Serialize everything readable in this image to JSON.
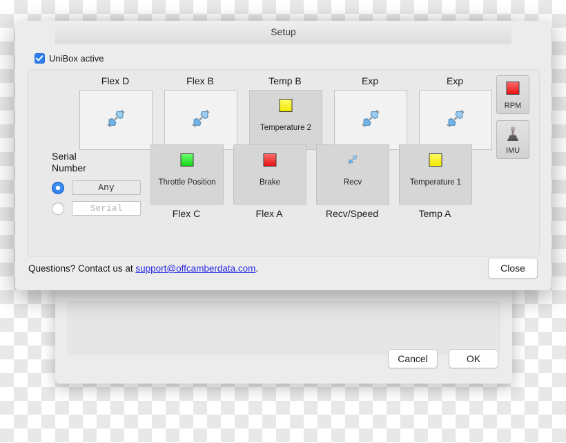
{
  "background_window": {
    "title": "Setup",
    "traffic_lights": [
      "close-disabled",
      "minimize-disabled",
      "zoom-active"
    ],
    "cancel_label": "Cancel",
    "ok_label": "OK"
  },
  "dialog": {
    "title": "Setup",
    "unibox_checkbox": {
      "label": "UniBox active",
      "checked": true,
      "accent": "#2b7ef0"
    },
    "channels_top": [
      {
        "caption": "Flex D",
        "state": "unplugged",
        "indicator": "plug-icon",
        "text": ""
      },
      {
        "caption": "Flex B",
        "state": "unplugged",
        "indicator": "plug-icon",
        "text": ""
      },
      {
        "caption": "Temp B",
        "state": "assigned",
        "indicator": "yellow",
        "text": "Temperature 2"
      },
      {
        "caption": "Exp",
        "state": "unplugged",
        "indicator": "plug-icon",
        "text": ""
      },
      {
        "caption": "Exp",
        "state": "unplugged",
        "indicator": "plug-icon",
        "text": ""
      }
    ],
    "channels_bottom": [
      {
        "caption": "Flex C",
        "state": "assigned",
        "indicator": "green",
        "text": "Throttle Position"
      },
      {
        "caption": "Flex A",
        "state": "assigned",
        "indicator": "red",
        "text": "Brake"
      },
      {
        "caption": "Recv/Speed",
        "state": "assigned",
        "indicator": "plug-icon-small",
        "text": "Recv"
      },
      {
        "caption": "Temp A",
        "state": "assigned",
        "indicator": "yellow",
        "text": "Temperature 1"
      }
    ],
    "side_buttons": [
      {
        "label": "RPM",
        "indicator": "red"
      },
      {
        "label": "IMU",
        "indicator": "joystick-icon"
      }
    ],
    "serial": {
      "title_line1": "Serial",
      "title_line2": "Number",
      "option_any": {
        "selected": true,
        "value": "Any"
      },
      "option_serial": {
        "selected": false,
        "placeholder": "Serial",
        "value": ""
      }
    },
    "footer": {
      "text_before": "Questions? Contact us at ",
      "link": "support@offcamberdata.com",
      "text_after": ".",
      "link_color": "#2a2ae0"
    },
    "close_label": "Close"
  },
  "indicator_colors": {
    "yellow": "#f5ec00",
    "green": "#17d417",
    "red": "#e81111"
  }
}
